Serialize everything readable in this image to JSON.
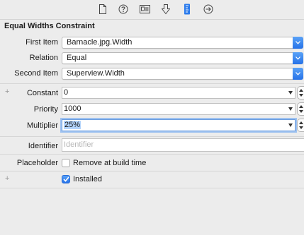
{
  "section_title": "Equal Widths Constraint",
  "tabs": [
    {
      "icon": "file-icon"
    },
    {
      "icon": "help-icon"
    },
    {
      "icon": "identity-icon"
    },
    {
      "icon": "attributes-icon"
    },
    {
      "icon": "size-icon"
    },
    {
      "icon": "connections-icon"
    }
  ],
  "first_item": {
    "label": "First Item",
    "value": "Barnacle.jpg.Width"
  },
  "relation": {
    "label": "Relation",
    "value": "Equal"
  },
  "second_item": {
    "label": "Second Item",
    "value": "Superview.Width"
  },
  "constant": {
    "label": "Constant",
    "value": "0"
  },
  "priority": {
    "label": "Priority",
    "value": "1000"
  },
  "multiplier": {
    "label": "Multiplier",
    "value": "25%"
  },
  "identifier": {
    "label": "Identifier",
    "placeholder": "Identifier"
  },
  "placeholder": {
    "label": "Placeholder",
    "checkbox_label": "Remove at build time",
    "checked": false
  },
  "installed": {
    "checkbox_label": "Installed",
    "checked": true
  },
  "plus_symbol": "+",
  "colors": {
    "accent": "#2672e8",
    "background": "#ececec",
    "selection": "#b2d3fb"
  }
}
